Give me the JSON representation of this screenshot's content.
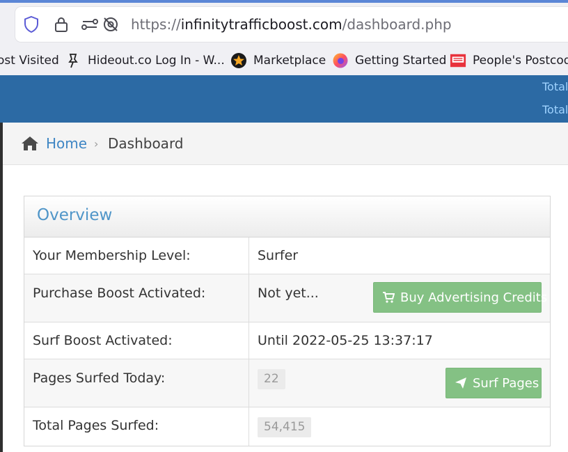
{
  "browser": {
    "url_scheme": "https://",
    "url_host": "infinitytrafficboost.com",
    "url_path": "/dashboard.php",
    "bookmarks": [
      {
        "label": "ost Visited",
        "icon": "none"
      },
      {
        "label": "Hideout.co Log In - W...",
        "icon": "pin-icon"
      },
      {
        "label": "Marketplace",
        "icon": "star-badge-icon"
      },
      {
        "label": "Getting Started",
        "icon": "firefox-icon"
      },
      {
        "label": "People's Postcode",
        "icon": "postcode-icon"
      }
    ]
  },
  "header": {
    "stats": [
      "Total",
      "Total"
    ]
  },
  "breadcrumb": {
    "home": "Home",
    "separator": "›",
    "current": "Dashboard"
  },
  "overview": {
    "title": "Overview",
    "rows": [
      {
        "label": "Your Membership Level:",
        "value": "Surfer"
      },
      {
        "label": "Purchase Boost Activated:",
        "value": "Not yet...",
        "button": "Buy Advertising Credits"
      },
      {
        "label": "Surf Boost Activated:",
        "value": "Until 2022-05-25 13:37:17"
      },
      {
        "label": "Pages Surfed Today:",
        "value": "22",
        "button": "Surf Pages"
      },
      {
        "label": "Total Pages Surfed:",
        "value": "54,415"
      }
    ]
  },
  "colors": {
    "header_bg": "#2c6aa4",
    "accent_link": "#3f86c4",
    "button_green": "#84c184"
  }
}
